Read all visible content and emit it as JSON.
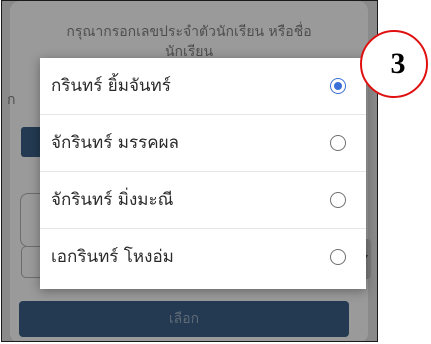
{
  "background": {
    "hint_line1": "กรุณากรอกเลขประจำตัวนักเรียน หรือชื่อ",
    "hint_line2": "นักเรียน",
    "left_fragment": "ก",
    "select_button_label": "เลือก"
  },
  "modal": {
    "options": [
      {
        "label": "กรินทร์ ยิ้มจันทร์",
        "selected": true
      },
      {
        "label": "จักรินทร์ มรรคผล",
        "selected": false
      },
      {
        "label": "จักรินทร์ มิ่งมะณี",
        "selected": false
      },
      {
        "label": "เอกรินทร์ โหงอ่ม",
        "selected": false
      }
    ]
  },
  "annotation": {
    "step_number": "3"
  },
  "colors": {
    "accent_radio": "#3b6fd8",
    "button_navy": "#233a52",
    "annotation_red": "#e01010"
  }
}
